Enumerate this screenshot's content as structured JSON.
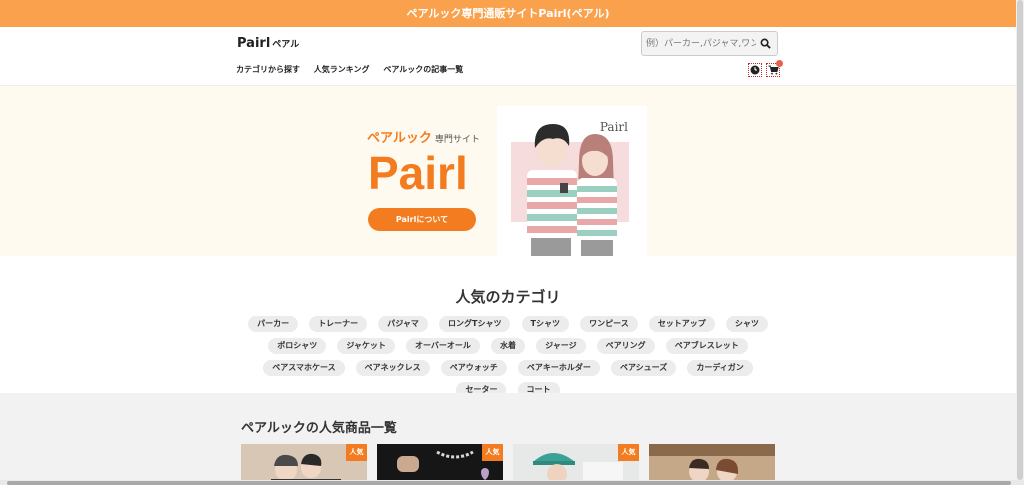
{
  "topbar": {
    "text": "ペアルック専門通販サイトPairl(ペアル)"
  },
  "header": {
    "logo": "Pairl",
    "logo_sub": "ペアル",
    "search_placeholder": "例）パーカー,パジャマ,ワンピ",
    "nav": [
      "カテゴリから探す",
      "人気ランキング",
      "ペアルックの記事一覧"
    ],
    "icons": [
      "history-icon",
      "cart-icon"
    ]
  },
  "hero": {
    "tag": "ペアルック",
    "tag_small": "専門サイト",
    "title": "Pairl",
    "button": "Pairlについて",
    "image_brand": "Pairl"
  },
  "categories": {
    "title": "人気のカテゴリ",
    "items": [
      "パーカー",
      "トレーナー",
      "パジャマ",
      "ロングTシャツ",
      "Tシャツ",
      "ワンピース",
      "セットアップ",
      "シャツ",
      "ポロシャツ",
      "ジャケット",
      "オーバーオール",
      "水着",
      "ジャージ",
      "ペアリング",
      "ペアブレスレット",
      "ペアスマホケース",
      "ペアネックレス",
      "ペアウォッチ",
      "ペアキーホルダー",
      "ペアシューズ",
      "カーディガン",
      "セーター",
      "コート"
    ]
  },
  "popular": {
    "title": "ペアルックの人気商品一覧",
    "badge": "人気",
    "cards": [
      {
        "badge": "人気"
      },
      {
        "badge": "人気"
      },
      {
        "badge": "人気"
      },
      {
        "badge": ""
      }
    ]
  },
  "colors": {
    "accent": "#f47c20",
    "topbar": "#f9a14d",
    "hero_bg": "#fffaf0"
  }
}
